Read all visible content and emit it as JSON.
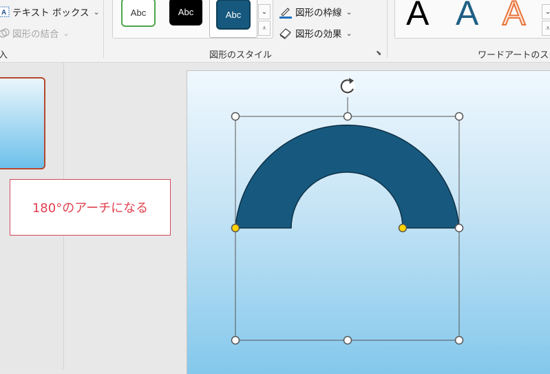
{
  "ribbon": {
    "insert_group": {
      "textbox_label": "テキスト ボックス",
      "merge_shapes_label": "図形の結合",
      "group_label_partial": "入"
    },
    "shape_styles": {
      "group_label": "図形のスタイル",
      "swatches": [
        {
          "text": "Abc",
          "fill": "#ffffff",
          "border": "#4ca64c",
          "color": "#333333"
        },
        {
          "text": "Abc",
          "fill": "#000000",
          "border": "#000000",
          "color": "#ffffff"
        },
        {
          "text": "Abc",
          "fill": "#17597e",
          "border": "#0e3d58",
          "color": "#ffffff"
        }
      ],
      "outline_label": "図形の枠線",
      "effects_label": "図形の効果"
    },
    "wordart": {
      "group_label": "ワードアートのスタ",
      "letters": [
        {
          "text": "A",
          "style": "black-fill"
        },
        {
          "text": "A",
          "style": "blue-fill"
        },
        {
          "text": "A",
          "style": "orange-outline"
        }
      ]
    }
  },
  "callout": {
    "text": "180°のアーチになる"
  },
  "shape": {
    "type": "arch",
    "sweep_degrees": 180,
    "fill": "#17597e",
    "outline": "#0d2f45"
  },
  "colors": {
    "handle_yellow": "#ffd400",
    "callout_red": "#e0404f",
    "thumbnail_border": "#b5472b"
  }
}
